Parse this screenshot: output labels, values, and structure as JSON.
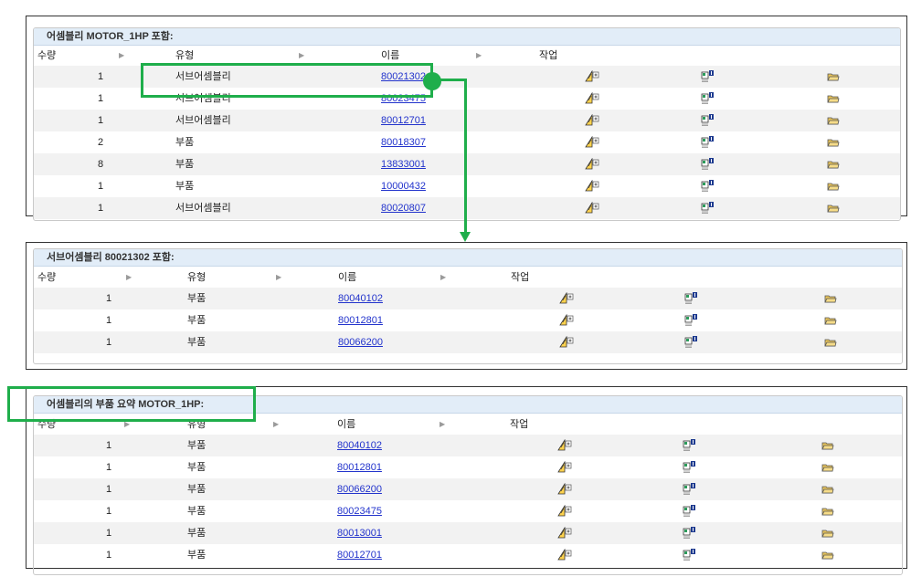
{
  "columns": {
    "qty": "수량",
    "type": "유형",
    "name": "이름",
    "action": "작업"
  },
  "icons": {
    "edit": "edit-structure-icon",
    "info": "document-info-icon",
    "open": "open-folder-icon"
  },
  "colors": {
    "highlight": "#1fae4b",
    "title_bar": "#e2edf8",
    "link": "#2233cc"
  },
  "panel1": {
    "title": "어셈블리 MOTOR_1HP 포함:",
    "rows": [
      {
        "qty": "1",
        "type": "서브어셈블리",
        "name": "80021302"
      },
      {
        "qty": "1",
        "type": "서브어셈블리",
        "name": "80023475"
      },
      {
        "qty": "1",
        "type": "서브어셈블리",
        "name": "80012701"
      },
      {
        "qty": "2",
        "type": "부품",
        "name": "80018307"
      },
      {
        "qty": "8",
        "type": "부품",
        "name": "13833001"
      },
      {
        "qty": "1",
        "type": "부품",
        "name": "10000432"
      },
      {
        "qty": "1",
        "type": "서브어셈블리",
        "name": "80020807"
      }
    ]
  },
  "panel2": {
    "title": "서브어셈블리 80021302 포함:",
    "rows": [
      {
        "qty": "1",
        "type": "부품",
        "name": "80040102"
      },
      {
        "qty": "1",
        "type": "부품",
        "name": "80012801"
      },
      {
        "qty": "1",
        "type": "부품",
        "name": "80066200"
      }
    ]
  },
  "panel3": {
    "title": "어셈블리의 부품 요약 MOTOR_1HP:",
    "rows": [
      {
        "qty": "1",
        "type": "부품",
        "name": "80040102"
      },
      {
        "qty": "1",
        "type": "부품",
        "name": "80012801"
      },
      {
        "qty": "1",
        "type": "부품",
        "name": "80066200"
      },
      {
        "qty": "1",
        "type": "부품",
        "name": "80023475"
      },
      {
        "qty": "1",
        "type": "부품",
        "name": "80013001"
      },
      {
        "qty": "1",
        "type": "부품",
        "name": "80012701"
      }
    ]
  }
}
